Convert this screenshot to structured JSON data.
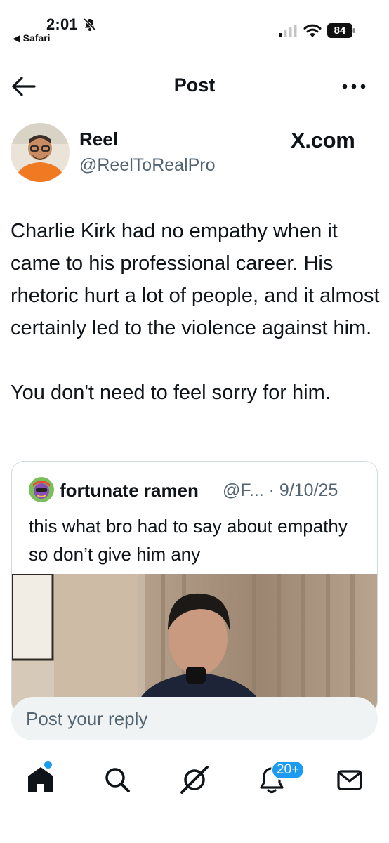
{
  "status_bar": {
    "time": "2:01",
    "back_app": "◀ Safari",
    "battery": "84"
  },
  "header": {
    "title": "Post"
  },
  "post": {
    "author_name": "Reel",
    "author_handle": "@ReelToRealPro",
    "source_badge": "X.com",
    "paragraphs": [
      "Charlie Kirk had no empathy when it came to his professional career. His rhetoric hurt a lot of people, and it almost certainly led to the violence against him.",
      "You don't need to feel sorry for him."
    ]
  },
  "quote": {
    "author_name": "fortunate ramen",
    "author_handle": "@F... · 9/10/25",
    "text": "this what bro had to say about empathy so don’t give him any"
  },
  "reply": {
    "placeholder": "Post your reply"
  },
  "tabs": {
    "notification_badge": "20+",
    "icons": [
      "home-icon",
      "search-icon",
      "grok-icon",
      "notifications-icon",
      "messages-icon"
    ]
  },
  "colors": {
    "accent": "#1d9bf0",
    "secondary_text": "#536471",
    "border": "#cfd9de",
    "input_bg": "#eff3f4"
  }
}
